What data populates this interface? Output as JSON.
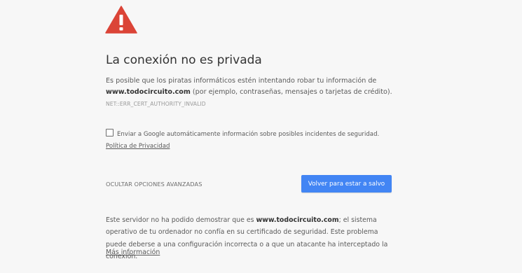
{
  "interstitial": {
    "icon": "warning-triangle-icon",
    "title": "La conexión no es privada",
    "description": {
      "before": "Es posible que los piratas informáticos estén intentando robar tu información de ",
      "domain": "www.todocircuito.com",
      "after": " (por ejemplo, contraseñas, mensajes o tarjetas de crédito)."
    },
    "error_code": "NET::ERR_CERT_AUTHORITY_INVALID",
    "optin": {
      "checked": false,
      "label": "Enviar a Google automáticamente información sobre posibles incidentes de seguridad.",
      "link_text": "Política de Privacidad"
    },
    "advanced_toggle": "OCULTAR OPCIONES AVANZADAS",
    "primary_button": "Volver para estar a salvo",
    "details": {
      "before": "Este servidor no ha podido demostrar que es ",
      "domain": "www.todocircuito.com",
      "after": "; el sistema operativo de tu ordenador no confía en su certificado de seguridad. Este problema puede deberse a una configuración incorrecta o a que un atacante ha interceptado la conexión."
    },
    "more_info_link": "Más información"
  },
  "colors": {
    "background": "#f7f7f7",
    "warning_red": "#db4437",
    "primary_blue": "#4285f4",
    "title_text": "#333333",
    "body_text": "#5a5a5a"
  }
}
